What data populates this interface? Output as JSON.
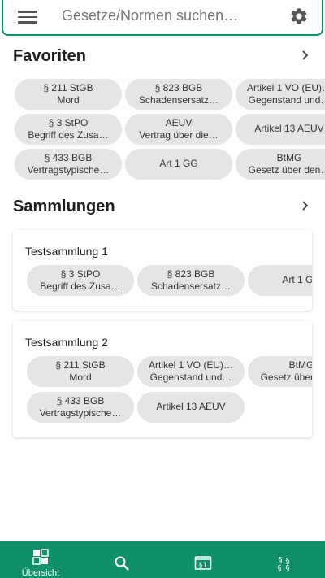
{
  "search": {
    "placeholder": "Gesetze/Normen suchen…"
  },
  "favorites": {
    "title": "Favoriten",
    "chips": [
      {
        "line1": "§ 211 StGB",
        "line2": "Mord"
      },
      {
        "line1": "§ 823 BGB",
        "line2": "Schadensersatz…"
      },
      {
        "line1": "Artikel 1 VO (EU)…",
        "line2": "Gegenstand und…"
      },
      {
        "line1": "§ 3 StPO",
        "line2": "Begriff des Zusa…"
      },
      {
        "line1": "AEUV",
        "line2": "Vertrag über die…"
      },
      {
        "line1": "Artikel 13 AEUV",
        "line2": ""
      },
      {
        "line1": "§ 433 BGB",
        "line2": "Vertragstypische…"
      },
      {
        "line1": "Art 1 GG",
        "line2": ""
      },
      {
        "line1": "BtMG",
        "line2": "Gesetz über den…"
      }
    ]
  },
  "collections": {
    "title": "Sammlungen",
    "items": [
      {
        "name": "Testsammlung 1",
        "chips": [
          {
            "line1": "§ 3 StPO",
            "line2": "Begriff des Zusa…"
          },
          {
            "line1": "§ 823 BGB",
            "line2": "Schadensersatz…"
          },
          {
            "line1": "Art 1 GG",
            "line2": ""
          }
        ]
      },
      {
        "name": "Testsammlung 2",
        "chips": [
          {
            "line1": "§ 211 StGB",
            "line2": "Mord"
          },
          {
            "line1": "Artikel 1 VO (EU)…",
            "line2": "Gegenstand und…"
          },
          {
            "line1": "BtMG",
            "line2": "Gesetz über den…"
          },
          {
            "line1": "§ 433 BGB",
            "line2": "Vertragstypische…"
          },
          {
            "line1": "Artikel 13 AEUV",
            "line2": ""
          }
        ]
      }
    ]
  },
  "nav": {
    "items": [
      {
        "label": "Übersicht",
        "icon": "overview-icon",
        "active": true
      },
      {
        "label": "",
        "icon": "search-icon",
        "active": false
      },
      {
        "label": "",
        "icon": "law-book-icon",
        "active": false
      },
      {
        "label": "",
        "icon": "paragraphs-icon",
        "active": false
      }
    ]
  },
  "colors": {
    "accent": "#0f8f6a",
    "chip": "#e5e5e5"
  }
}
